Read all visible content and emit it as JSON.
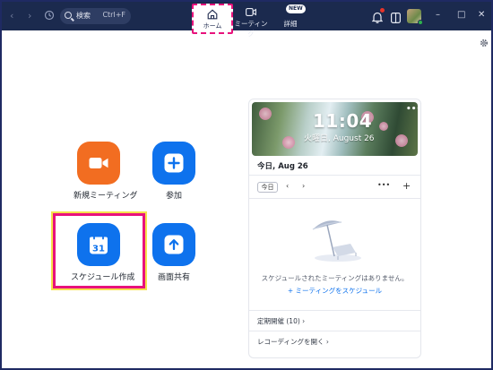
{
  "titlebar": {
    "back_icon": "chevron-left-icon",
    "forward_icon": "chevron-right-icon",
    "history_icon": "history-icon",
    "search": {
      "label": "検索",
      "shortcut": "Ctrl+F"
    },
    "tabs": [
      {
        "label": "ホーム",
        "icon": "home-icon",
        "selected": true
      },
      {
        "label": "ミーティング",
        "icon": "video-camera-icon"
      },
      {
        "label": "詳細",
        "badge": "NEW"
      }
    ],
    "window_controls": {
      "minimize": "–",
      "maximize": "□",
      "close": "✕"
    }
  },
  "home": {
    "buttons": [
      {
        "label": "新規ミーティング",
        "icon": "video-camera-icon",
        "color": "#f26d21",
        "dropdown": "⌄"
      },
      {
        "label": "参加",
        "icon": "plus-icon",
        "color": "#0e72ed"
      },
      {
        "label": "スケジュール作成",
        "icon": "calendar-icon",
        "calendar_day": "31",
        "color": "#0e72ed",
        "highlighted": true
      },
      {
        "label": "画面共有",
        "icon": "share-screen-icon",
        "color": "#0e72ed"
      }
    ]
  },
  "calendar": {
    "time": "11:04",
    "date": "火曜日, August 26",
    "more": "•••",
    "day_header": "今日, Aug 26",
    "today_button": "今日",
    "prev": "‹",
    "next": "›",
    "more_options": "•••",
    "add": "+",
    "empty_message": "スケジュールされたミーティングはありません。",
    "schedule_link": "+ ミーティングをスケジュール",
    "recurring": "定期開催 (10)  ›",
    "open_recordings": "レコーディングを開く  ›"
  },
  "colors": {
    "titlebar": "#1b2a4e",
    "accent": "#0e72ed",
    "orange": "#f26d21",
    "highlight": "#e8127c"
  }
}
